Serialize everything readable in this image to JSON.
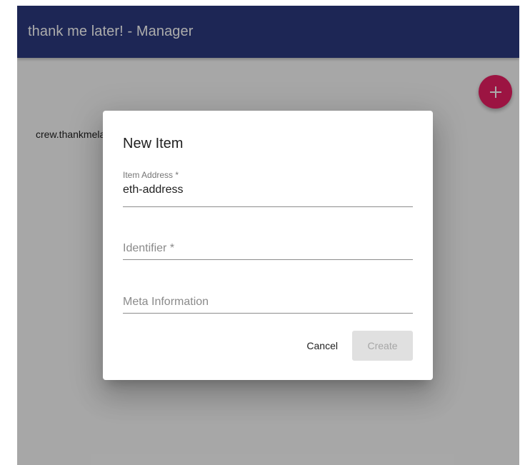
{
  "appbar": {
    "title": "thank me later! - Manager",
    "color": "#2c3a7f"
  },
  "list": {
    "items": [
      {
        "label": "crew.thankmelater.eth"
      }
    ]
  },
  "fab": {
    "icon": "plus-icon",
    "color": "#e91e63"
  },
  "dialog": {
    "title": "New Item",
    "fields": {
      "item_address": {
        "label": "Item Address *",
        "value": "eth-address"
      },
      "identifier": {
        "placeholder": "Identifier *"
      },
      "meta_information": {
        "placeholder": "Meta Information"
      }
    },
    "actions": {
      "cancel_label": "Cancel",
      "create_label": "Create"
    }
  }
}
